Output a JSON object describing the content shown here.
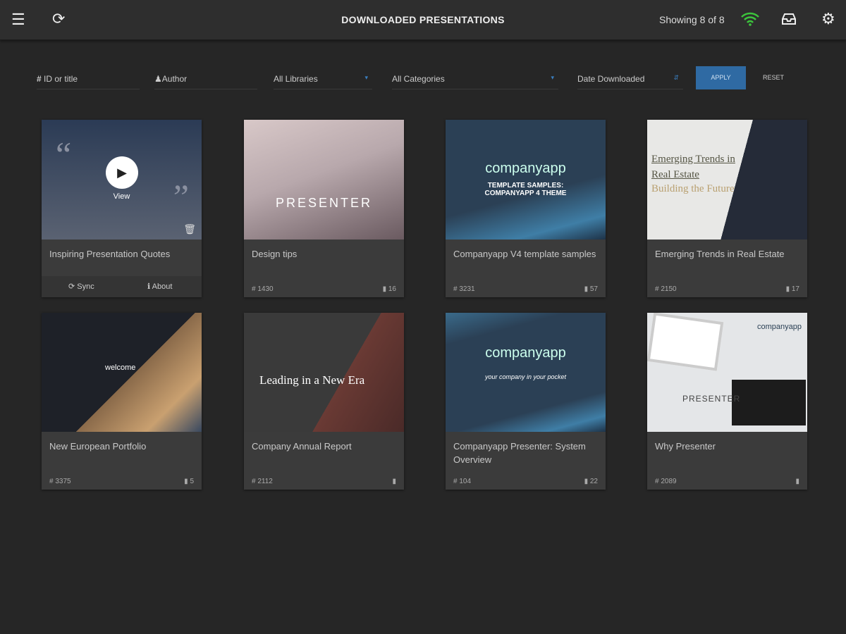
{
  "header": {
    "title": "DOWNLOADED PRESENTATIONS",
    "showing": "Showing 8 of 8",
    "colors": {
      "wifi": "#3cc43c",
      "accent": "#2f6aa3"
    }
  },
  "filters": {
    "id_placeholder": "ID or title",
    "author_placeholder": "Author",
    "library": "All Libraries",
    "category": "All Categories",
    "date": "Date Downloaded",
    "apply": "APPLY",
    "reset": "RESET"
  },
  "cards": [
    {
      "title": "Inspiring Presentation Quotes",
      "view": "View",
      "sync": "Sync",
      "about": "About"
    },
    {
      "title": "Design tips",
      "id": "1430",
      "pages": "16",
      "thumb_text": "PRESENTER"
    },
    {
      "title": "Companyapp V4 template samples",
      "id": "3231",
      "pages": "57",
      "thumb_logo": "companyapp",
      "thumb_text": "TEMPLATE SAMPLES: COMPANYAPP 4 THEME"
    },
    {
      "title": "Emerging Trends in Real Estate",
      "id": "2150",
      "pages": "17",
      "thumb_text": "Emerging Trends in Real Estate",
      "thumb_sub": "Building the Future"
    },
    {
      "title": "New European Portfolio",
      "id": "3375",
      "pages": "5",
      "thumb_text": "welcome"
    },
    {
      "title": "Company Annual Report",
      "id": "2112",
      "pages": "",
      "thumb_text": "Leading in a New Era"
    },
    {
      "title": "Companyapp Presenter: System Overview",
      "id": "104",
      "pages": "22",
      "thumb_logo": "companyapp",
      "thumb_text": "your company in your pocket"
    },
    {
      "title": "Why Presenter",
      "id": "2089",
      "pages": "",
      "thumb_logo": "companyapp",
      "thumb_text": "PRESENTER"
    }
  ]
}
